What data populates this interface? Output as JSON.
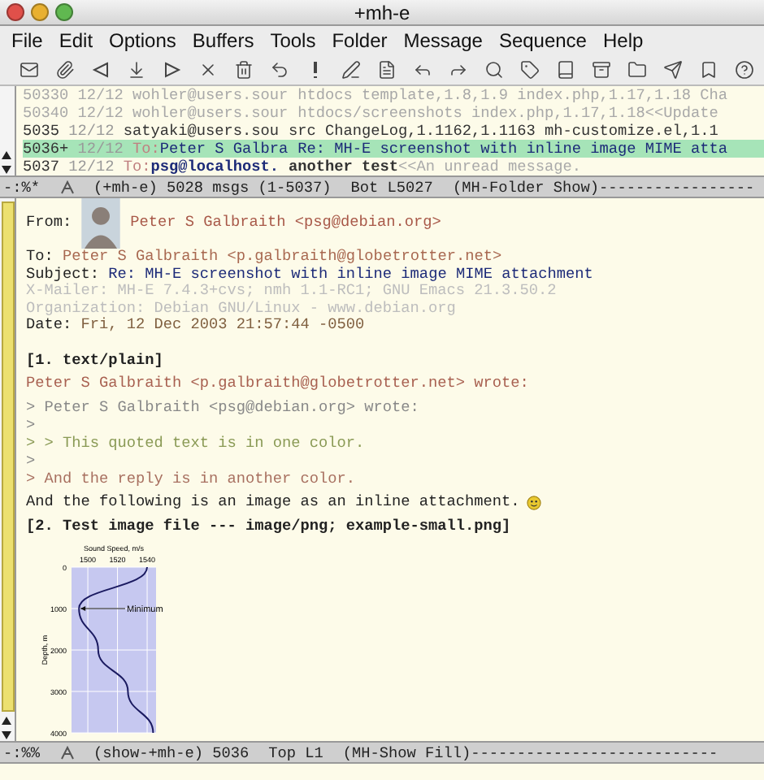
{
  "window": {
    "title": "+mh-e"
  },
  "menu": [
    "File",
    "Edit",
    "Options",
    "Buffers",
    "Tools",
    "Folder",
    "Message",
    "Sequence",
    "Help"
  ],
  "summary": [
    {
      "number": "50330",
      "date": "12/12",
      "from": "wohler@users.sour",
      "subject": "htdocs template,1.8,1.9 index.php,1.17,1.18 Cha",
      "faded": true,
      "selected": false,
      "unread": false
    },
    {
      "number": "50340",
      "date": "12/12",
      "from": "wohler@users.sour",
      "subject": "htdocs/screenshots index.php,1.17,1.18<<Update",
      "faded": true,
      "selected": false,
      "unread": false
    },
    {
      "number": "5035",
      "date": "12/12",
      "from": "satyaki@users.sou",
      "subject": "src ChangeLog,1.1162,1.1163 mh-customize.el,1.1",
      "faded": false,
      "selected": false,
      "unread": false
    },
    {
      "number": "5036+",
      "date": "12/12",
      "to": "To:",
      "from": "Peter S Galbra",
      "subject": "Re: MH-E screenshot with inline image MIME atta",
      "faded": false,
      "selected": true,
      "unread": false
    },
    {
      "number": "5037",
      "date": "12/12",
      "to": "To:",
      "from": "psg@localhost.",
      "subject": "another test",
      "preview": "<<An unread message.",
      "faded": false,
      "selected": false,
      "unread": true
    }
  ],
  "folder_mode_line": [
    "-:%*",
    "(+mh-e) 5028 msgs (1-5037)",
    "Bot L5027",
    "(MH-Folder Show)-----------------"
  ],
  "headers": [
    {
      "kind": "from",
      "label": "From:",
      "value": "Peter S Galbraith <psg@debian.org>"
    },
    {
      "kind": "to",
      "label": "To:",
      "value": "Peter S Galbraith <p.galbraith@globetrotter.net>"
    },
    {
      "kind": "subject",
      "label": "Subject:",
      "value": "Re: MH-E screenshot with inline image MIME attachment"
    },
    {
      "kind": "faded",
      "text": "X-Mailer: MH-E 7.4.3+cvs; nmh 1.1-RC1; GNU Emacs 21.3.50.2"
    },
    {
      "kind": "faded",
      "text": "Organization: Debian GNU/Linux - www.debian.org"
    },
    {
      "kind": "date",
      "label": "Date:",
      "value": "Fri, 12 Dec 2003 21:57:44 -0500"
    }
  ],
  "body": [
    {
      "kind": "part",
      "text": "[1. text/plain]"
    },
    {
      "kind": "paragraph",
      "lines": [
        {
          "kind": "attribution",
          "text": "Peter S Galbraith <p.galbraith@globetrotter.net> wrote:"
        }
      ]
    },
    {
      "kind": "paragraph",
      "lines": [
        {
          "kind": "quote",
          "text": "> Peter S Galbraith <psg@debian.org> wrote:"
        },
        {
          "kind": "quote",
          "text": ">"
        },
        {
          "kind": "quote2",
          "text": "> > This quoted text is in one color."
        },
        {
          "kind": "quote",
          "text": ">"
        },
        {
          "kind": "reply",
          "text": "> And the reply is in another color."
        }
      ]
    },
    {
      "kind": "paragraph",
      "lines": [
        {
          "kind": "plain",
          "text": "And the following is an image as an inline attachment.",
          "smiley": true
        }
      ]
    },
    {
      "kind": "part",
      "text": "[2. Test image file --- image/png; example-small.png]"
    }
  ],
  "chart_data": {
    "type": "line",
    "title": "Sound Speed, m/s",
    "ylabel": "Depth, m",
    "orientation": "horizontal",
    "grid": true,
    "categories": [
      0,
      1000,
      2000,
      3000,
      4000
    ],
    "series": [
      {
        "color": "#1a1a60",
        "values": [
          1540,
          1494,
          1507,
          1527,
          1544
        ]
      }
    ],
    "xlim": [
      1489,
      1546
    ],
    "xticks": [
      1500,
      1520,
      1540
    ],
    "annotations": [
      "Minimum"
    ]
  },
  "show_mode_line": [
    "-:%%",
    "(show-+mh-e) 5036",
    "Top L1",
    "(MH-Show Fill)---------------------------"
  ]
}
